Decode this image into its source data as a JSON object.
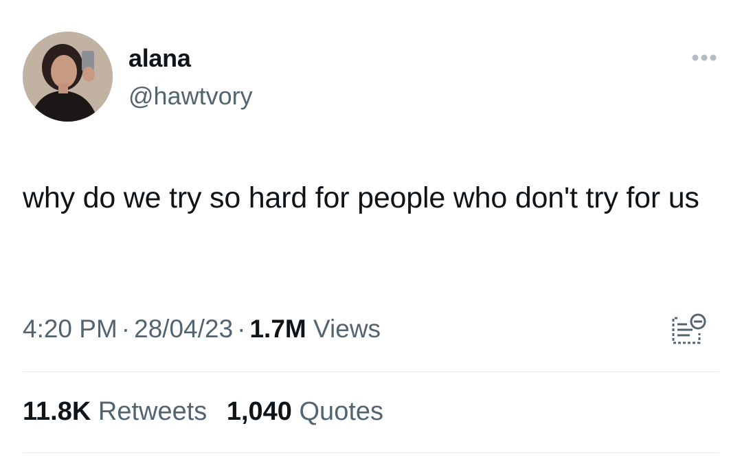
{
  "author": {
    "name": "alana",
    "handle": "@hawtvory",
    "avatar_icon": "profile-photo"
  },
  "tweet": {
    "text": "why do we try so hard for people who don't try for us"
  },
  "meta": {
    "time": "4:20 PM",
    "separator": "·",
    "date": "28/04/23",
    "views_count": "1.7M",
    "views_label": "Views"
  },
  "stats": {
    "retweets_count": "11.8K",
    "retweets_label": "Retweets",
    "quotes_count": "1,040",
    "quotes_label": "Quotes"
  },
  "icons": {
    "more": "more-options-icon",
    "analytics": "analytics-icon"
  },
  "colors": {
    "text": "#0f1419",
    "secondary": "#536471",
    "divider": "#eff3f4"
  }
}
